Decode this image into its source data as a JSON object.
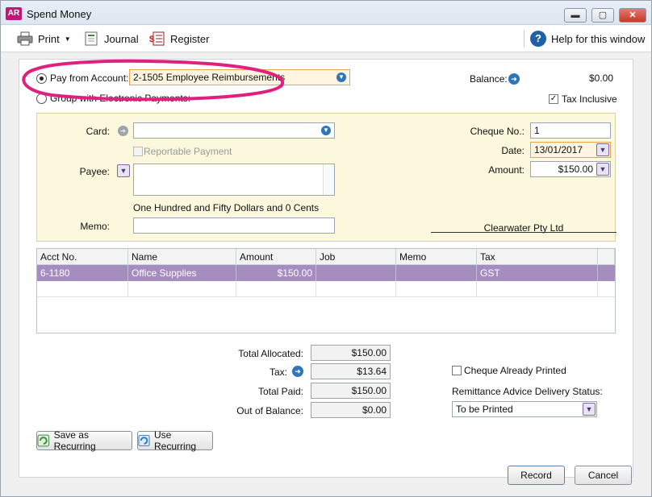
{
  "window": {
    "app_badge": "AR",
    "title": "Spend Money",
    "min": "▬",
    "max": "▢",
    "close": "✕"
  },
  "toolbar": {
    "print_label": "Print",
    "journal_label": "Journal",
    "register_label": "Register",
    "help_label": "Help for this window",
    "help_glyph": "?"
  },
  "payment": {
    "pay_from_label": "Pay from Account:",
    "pay_from_value": "2-1505 Employee Reimbursements",
    "group_label": "Group with Electronic Payments:",
    "balance_label": "Balance:",
    "balance_value": "$0.00",
    "tax_inclusive_label": "Tax Inclusive"
  },
  "cheque": {
    "card_label": "Card:",
    "card_value": "",
    "reportable_label": "Reportable Payment",
    "payee_label": "Payee:",
    "payee_value": "",
    "amount_words": "One Hundred and Fifty Dollars and 0 Cents",
    "memo_label": "Memo:",
    "memo_value": "",
    "cheque_no_label": "Cheque No.:",
    "cheque_no_value": "1",
    "date_label": "Date:",
    "date_value": "13/01/2017",
    "amount_label": "Amount:",
    "amount_value": "$150.00",
    "company_name": "Clearwater Pty Ltd"
  },
  "table": {
    "columns": [
      "Acct No.",
      "Name",
      "Amount",
      "Job",
      "Memo",
      "Tax"
    ],
    "rows": [
      [
        "6-1180",
        "Office Supplies",
        "$150.00",
        "",
        "",
        "GST"
      ]
    ]
  },
  "totals": {
    "total_allocated_label": "Total Allocated:",
    "total_allocated_value": "$150.00",
    "tax_label": "Tax:",
    "tax_value": "$13.64",
    "total_paid_label": "Total Paid:",
    "total_paid_value": "$150.00",
    "out_of_balance_label": "Out of Balance:",
    "out_of_balance_value": "$0.00"
  },
  "options": {
    "cheque_printed_label": "Cheque Already Printed",
    "remittance_label": "Remittance Advice Delivery Status:",
    "remittance_value": "To be Printed"
  },
  "buttons": {
    "save_recurring": "Save as Recurring",
    "use_recurring": "Use Recurring",
    "record": "Record",
    "cancel": "Cancel"
  },
  "colors": {
    "highlight": "#e0207e",
    "row_selected": "#a58dc0",
    "cheque_bg": "#fcf8dd"
  }
}
